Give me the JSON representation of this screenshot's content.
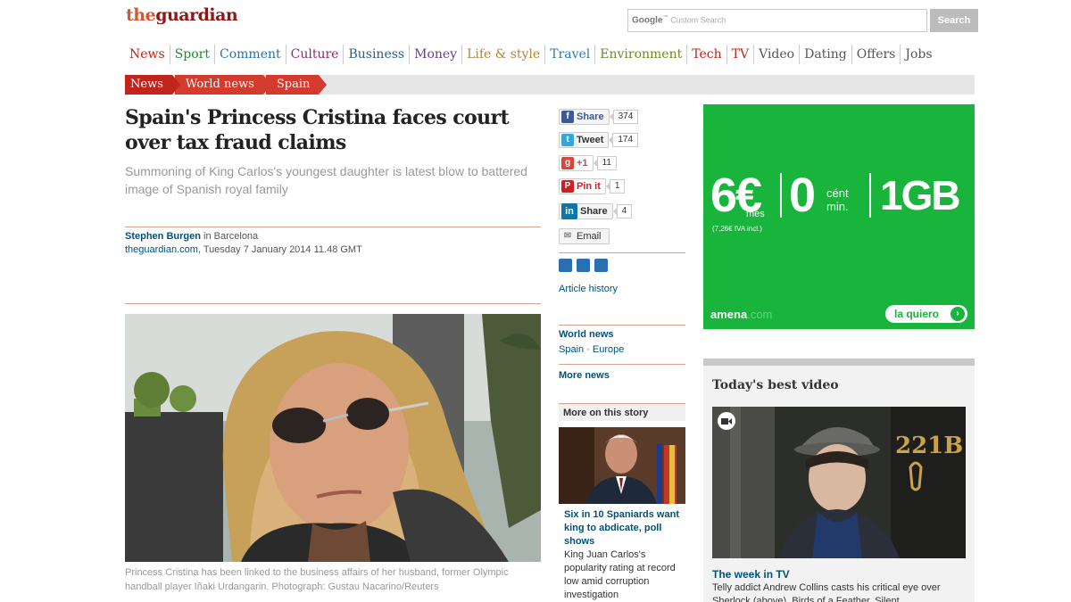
{
  "header": {
    "logo_the": "the",
    "logo_guardian": "guardian",
    "search": {
      "google_label": "Google",
      "placeholder": "Custom Search",
      "button_label": "Search"
    }
  },
  "nav": [
    {
      "label": "News",
      "color": "#c1241a"
    },
    {
      "label": "Sport",
      "color": "#1b8b2e"
    },
    {
      "label": "Comment",
      "color": "#2a72a8"
    },
    {
      "label": "Culture",
      "color": "#8a2b7c"
    },
    {
      "label": "Business",
      "color": "#2e5e8e"
    },
    {
      "label": "Money",
      "color": "#6a3d8c"
    },
    {
      "label": "Life & style",
      "color": "#b7813a"
    },
    {
      "label": "Travel",
      "color": "#2c7ab0"
    },
    {
      "label": "Environment",
      "color": "#6b8e23"
    },
    {
      "label": "Tech",
      "color": "#c1241a"
    },
    {
      "label": "TV",
      "color": "#c1241a"
    },
    {
      "label": "Video",
      "color": "#555555"
    },
    {
      "label": "Dating",
      "color": "#555555"
    },
    {
      "label": "Offers",
      "color": "#555555"
    },
    {
      "label": "Jobs",
      "color": "#555555"
    }
  ],
  "breadcrumb": [
    "News",
    "World news",
    "Spain"
  ],
  "article": {
    "headline": "Spain's Princess Cristina faces court over tax fraud claims",
    "standfirst": "Summoning of King Carlos's youngest daughter is latest blow to battered image of Spanish royal family",
    "author": "Stephen Burgen",
    "location": "in Barcelona",
    "site": "theguardian.com",
    "date": ", Tuesday 7 January 2014 11.48 GMT",
    "caption": "Princess Cristina has been linked to the business affairs of her husband, former Olympic handball player Iñaki Urdangarin. Photograph: Gustau Nacarino/Reuters"
  },
  "share": [
    {
      "label": "Share",
      "count": "374",
      "icon": "facebook-icon",
      "icon_glyph": "f",
      "icon_color": "#3b5998"
    },
    {
      "label": "Tweet",
      "count": "174",
      "icon": "twitter-icon",
      "icon_glyph": "t",
      "icon_color": "#2fa8e0"
    },
    {
      "label": "+1",
      "count": "11",
      "icon": "googleplus-icon",
      "icon_glyph": "g",
      "icon_color": "#d34836"
    },
    {
      "label": "Pin it",
      "count": "1",
      "icon": "pinterest-icon",
      "icon_glyph": "P",
      "icon_color": "#cb2027"
    },
    {
      "label": "Share",
      "count": "4",
      "icon": "linkedin-icon",
      "icon_glyph": "in",
      "icon_color": "#0e76a8"
    },
    {
      "label": "Email",
      "count": "",
      "icon": "email-icon",
      "icon_glyph": "✉",
      "icon_color": "#888888"
    }
  ],
  "sidebar": {
    "article_history": "Article history",
    "world_news": "World news",
    "spain_europe": "Spain · Europe",
    "more_news": "More news",
    "more_on_story": "More on this story",
    "story_headline": "Six in 10 Spaniards want king to abdicate, poll shows",
    "story_trail": "King Juan Carlos's popularity rating at record low amid corruption investigation"
  },
  "ad": {
    "price": "6€",
    "price_sub": "mes",
    "price_note": "(7,26€ IVA incl.)",
    "cent": "0",
    "cent_sub1": "cént",
    "cent_sub2": "min.",
    "data": "1GB",
    "brand": "amena",
    "brand_suffix": ".com",
    "cta": "la quiero",
    "color": "#18b43b"
  },
  "video": {
    "title": "Today's best video",
    "label": "The week in TV",
    "trail": "Telly addict Andrew Collins casts his critical eye over Sherlock (above), Birds of a Feather, Silent",
    "door_number": "221B"
  }
}
